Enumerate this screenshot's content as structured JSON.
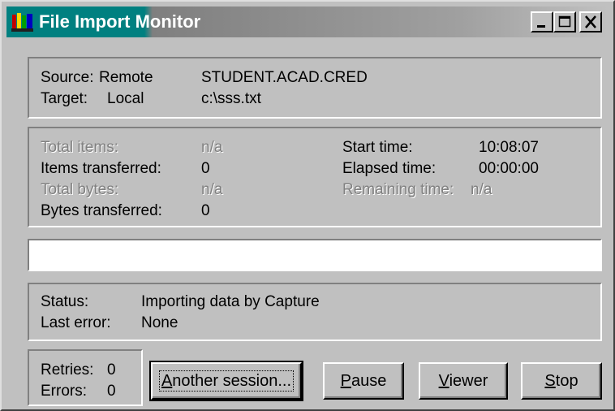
{
  "window": {
    "title_part1": "File Import",
    "title_part2": "Monitor",
    "controls": {
      "minimize": "minimize-icon",
      "maximize": "maximize-icon",
      "close": "close-icon"
    }
  },
  "connection": {
    "source_label": "Source:",
    "source_type": "Remote",
    "source_value": "STUDENT.ACAD.CRED",
    "target_label": "Target:",
    "target_type": "Local",
    "target_value": "c:\\sss.txt"
  },
  "stats": {
    "total_items_label": "Total items:",
    "total_items_value": "n/a",
    "items_transferred_label": "Items transferred:",
    "items_transferred_value": "0",
    "total_bytes_label": "Total bytes:",
    "total_bytes_value": "n/a",
    "bytes_transferred_label": "Bytes transferred:",
    "bytes_transferred_value": "0",
    "start_time_label": "Start time:",
    "start_time_value": "10:08:07",
    "elapsed_time_label": "Elapsed time:",
    "elapsed_time_value": "00:00:00",
    "remaining_time_label": "Remaining time:",
    "remaining_time_value": "n/a"
  },
  "progress": {
    "fraction": 0
  },
  "status": {
    "status_label": "Status:",
    "status_value": "Importing data by Capture",
    "last_error_label": "Last error:",
    "last_error_value": "None"
  },
  "counters": {
    "retries_label": "Retries:",
    "retries_value": "0",
    "errors_label": "Errors:",
    "errors_value": "0"
  },
  "buttons": {
    "another_session": {
      "mnemonic": "A",
      "rest": "nother session..."
    },
    "pause": {
      "mnemonic": "P",
      "rest": "ause"
    },
    "viewer": {
      "mnemonic": "V",
      "rest": "iewer"
    },
    "stop": {
      "mnemonic": "S",
      "rest": "top"
    }
  },
  "colors": {
    "face": "#c0c0c0",
    "title_active": "#008080",
    "title_inactive": "#a0a0a0",
    "disabled_text": "#808080",
    "progress_fill": "#000080"
  }
}
